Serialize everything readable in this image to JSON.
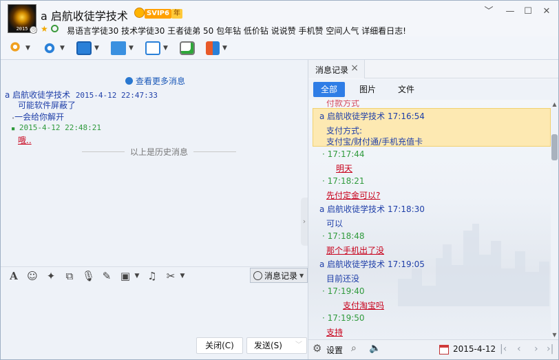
{
  "window": {
    "title": "a 启航收徒学技术",
    "vip_label": "SVIP6",
    "year_label": "年",
    "avatar_year": "2015",
    "signature": "易语言学徒30 技术学徒30 王者徒弟 50 包年钻 低价钻  说说赞 手机赞 空间人气 详细看日志!",
    "controls": {
      "menu": "﹀",
      "minimize": "—",
      "maximize": "☐",
      "close": "✕"
    }
  },
  "chat": {
    "more_link": "查看更多消息",
    "messages": [
      {
        "kind": "header",
        "sender": "a 启航收徒学技术",
        "time": "2015-4-12 22:47:33"
      },
      {
        "kind": "text",
        "text": "可能软件屏蔽了"
      },
      {
        "kind": "text",
        "text": "一会给你解开"
      },
      {
        "kind": "time",
        "time": "2015-4-12 22:48:21"
      },
      {
        "kind": "link",
        "text": "哦.."
      }
    ],
    "history_divider": "以上是历史消息"
  },
  "input_toolbar": {
    "history_button": "消息记录"
  },
  "buttons": {
    "close": "关闭(C)",
    "send": "发送(S)"
  },
  "history_panel": {
    "tab": "消息记录",
    "filters": [
      "全部",
      "图片",
      "文件"
    ],
    "partial_top": "付款方式",
    "items": [
      {
        "sender": "a 启航收徒学技术",
        "time": "17:16:54",
        "lines": [
          "支付方式:",
          "支付宝/财付通/手机充值卡"
        ]
      },
      {
        "time": "17:17:44",
        "text": "明天",
        "link": true
      },
      {
        "time": "17:18:21",
        "text": "先付定金可以?",
        "link": true
      },
      {
        "sender": "a 启航收徒学技术",
        "time": "17:18:30",
        "lines": [
          "可以"
        ]
      },
      {
        "time": "17:18:48",
        "text": "那个手机出了没",
        "link": true
      },
      {
        "sender": "a 启航收徒学技术",
        "time": "17:19:05",
        "lines": [
          "目前还没"
        ]
      },
      {
        "time": "17:19:40",
        "text": "支付淘宝吗",
        "link": true
      },
      {
        "time": "17:19:50",
        "text": "支持",
        "link": true
      }
    ],
    "settings": "设置",
    "date": "2015-4-12"
  },
  "colors": {
    "accent": "#2e7de6",
    "sender_blue": "#1f3fa8",
    "time_green": "#2f9a3c",
    "link_red": "#c8001a",
    "highlight": "#fde9b2"
  }
}
